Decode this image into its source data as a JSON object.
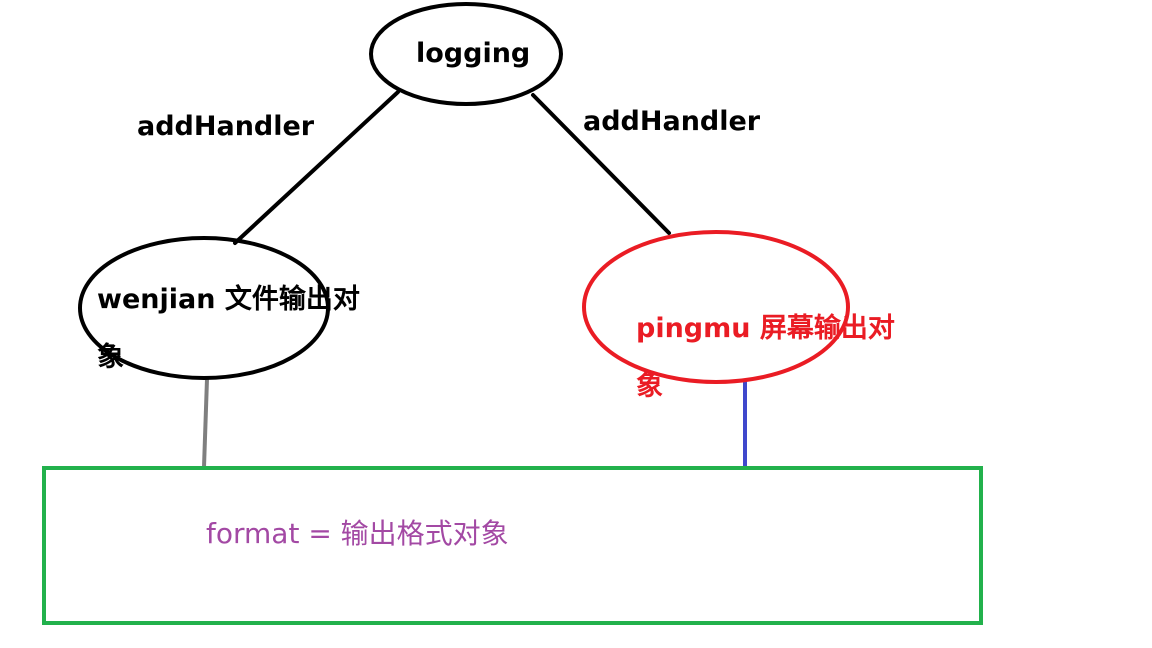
{
  "nodes": {
    "logging": {
      "label": "logging"
    },
    "wenjian": {
      "label": "wenjian 文件输出对象"
    },
    "pingmu": {
      "label": "pingmu 屏幕输出对象"
    },
    "format": {
      "label": "format = 输出格式对象"
    }
  },
  "edges": {
    "left_label": "addHandler",
    "right_label": "addHandler"
  },
  "colors": {
    "black": "#000000",
    "red": "#ea1c24",
    "green": "#22b14c",
    "gray": "#7f7f7f",
    "blue": "#3f48cc",
    "purple": "#a349a4"
  }
}
